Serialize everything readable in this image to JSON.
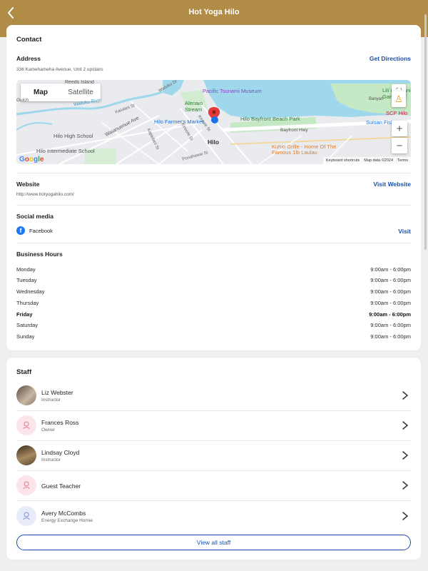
{
  "header": {
    "title": "Hot Yoga Hilo",
    "back_icon": "chevron-left-icon",
    "bg_color": "#b08c47"
  },
  "contact": {
    "heading": "Contact",
    "address_label": "Address",
    "address_value": "336 Kamehameha Avenue, Unit 2 upstairs",
    "directions_link": "Get Directions",
    "map": {
      "toggle_map": "Map",
      "toggle_satellite": "Satellite",
      "labels": {
        "reeds_island": "Reeds Island",
        "pacific_tsunami": "Pacific Tsunami Museum",
        "lili_gardens": "Lili`uokalani Gardens",
        "alenaio": "Alenaio Stream",
        "wailuku_river": "Wailuku River",
        "hilo_farmers": "Hilo Farmer's Market",
        "bayfront_park": "Hilo Bayfront Beach Park",
        "suisan": "Suisan Fish Mark",
        "scp_hilo": "SCP Hilo",
        "bayfront_hwy": "Bayfront Hwy",
        "hilo_high": "Hilo High School",
        "waianuenue": "Waianuenue Ave",
        "hilo": "Hilo",
        "kuhio_grille": "Kuhio Grille - Home Of The Famous 1lb Laulau",
        "hilo_intermediate": "Hilo Intermediate School",
        "gulch": "Gulch",
        "kaiulani": "Kaiulani St",
        "kapiolani": "Kapiolani St",
        "komohana": "Kinoole St",
        "ponahawai": "Ponahawai St",
        "keawe": "Keawe St",
        "wailuku_dr": "Wailuku Dr",
        "banyan": "Banyan"
      },
      "google": "Google",
      "footer_shortcuts": "Keyboard shortcuts",
      "footer_data": "Map data ©2024",
      "footer_terms": "Terms",
      "zoom_in": "+",
      "zoom_out": "−"
    },
    "website_label": "Website",
    "website_value": "http://www.hotyogahilo.com/",
    "website_link": "Visit Website",
    "social_label": "Social media",
    "social_name": "Facebook",
    "social_link": "Visit",
    "hours_label": "Business Hours",
    "hours": [
      {
        "day": "Monday",
        "time": "9:00am - 6:00pm"
      },
      {
        "day": "Tuesday",
        "time": "9:00am - 6:00pm"
      },
      {
        "day": "Wednesday",
        "time": "9:00am - 6:00pm"
      },
      {
        "day": "Thursday",
        "time": "9:00am - 6:00pm"
      },
      {
        "day": "Friday",
        "time": "9:00am - 6:00pm"
      },
      {
        "day": "Saturday",
        "time": "9:00am - 6:00pm"
      },
      {
        "day": "Sunday",
        "time": "9:00am - 6:00pm"
      }
    ]
  },
  "staff": {
    "heading": "Staff",
    "members": [
      {
        "name": "Liz Webster",
        "role": "Instructor"
      },
      {
        "name": "Frances Ross",
        "role": "Owner"
      },
      {
        "name": "Lindsay Cloyd",
        "role": "Instructor"
      },
      {
        "name": "Guest Teacher",
        "role": ""
      },
      {
        "name": "Avery McCombs",
        "role": "Energy Exchange Homie"
      }
    ],
    "view_all": "View all staff"
  },
  "colors": {
    "accent": "#1a4fa8",
    "brand": "#b08c47"
  }
}
